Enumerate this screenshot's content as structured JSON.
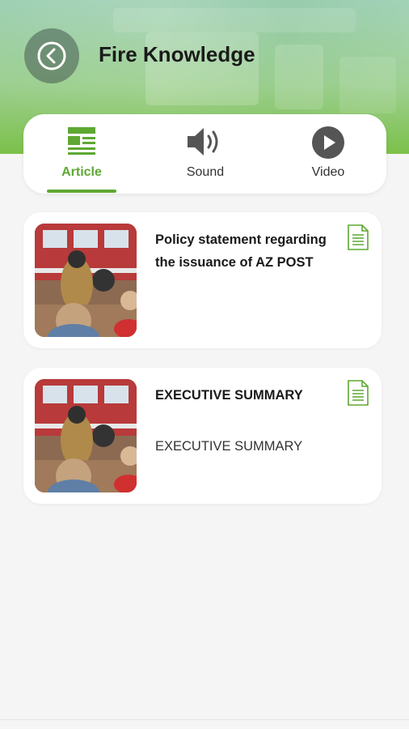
{
  "header": {
    "title": "Fire Knowledge",
    "back_icon": "chevron-left-icon"
  },
  "tabs": [
    {
      "label": "Article",
      "icon": "newspaper-icon",
      "active": true
    },
    {
      "label": "Sound",
      "icon": "speaker-icon",
      "active": false
    },
    {
      "label": "Video",
      "icon": "play-icon",
      "active": false
    }
  ],
  "articles": [
    {
      "title": "Policy statement regarding the issuance of AZ POST",
      "subtitle": "",
      "thumbnail": "firefighter-photo",
      "icon": "document-icon"
    },
    {
      "title": "EXECUTIVE SUMMARY",
      "subtitle": "EXECUTIVE SUMMARY",
      "thumbnail": "firefighter-photo",
      "icon": "document-icon"
    }
  ],
  "colors": {
    "accent": "#5ea832",
    "header_green": "#7cc04a"
  }
}
